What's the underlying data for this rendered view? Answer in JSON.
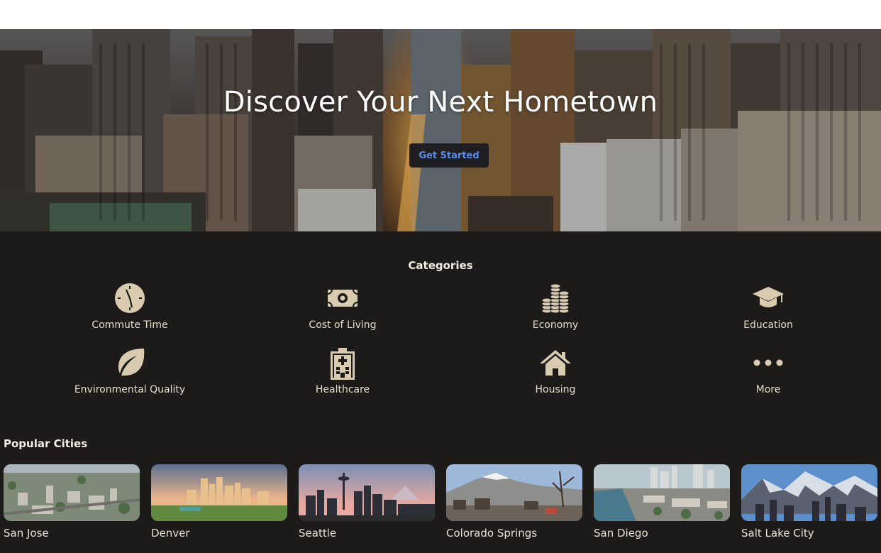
{
  "hero": {
    "title": "Discover Your Next Hometown",
    "cta_label": "Get Started"
  },
  "categories": {
    "title": "Categories",
    "items": [
      {
        "label": "Commute Time",
        "icon": "clock-icon"
      },
      {
        "label": "Cost of Living",
        "icon": "money-bill-icon"
      },
      {
        "label": "Economy",
        "icon": "coins-icon"
      },
      {
        "label": "Education",
        "icon": "graduation-cap-icon"
      },
      {
        "label": "Environmental Quality",
        "icon": "leaf-icon"
      },
      {
        "label": "Healthcare",
        "icon": "hospital-icon"
      },
      {
        "label": "Housing",
        "icon": "house-icon"
      },
      {
        "label": "More",
        "icon": "more-dots-icon"
      }
    ]
  },
  "popular": {
    "title": "Popular Cities",
    "cities": [
      {
        "name": "San Jose"
      },
      {
        "name": "Denver"
      },
      {
        "name": "Seattle"
      },
      {
        "name": "Colorado Springs"
      },
      {
        "name": "San Diego"
      },
      {
        "name": "Salt Lake City"
      }
    ]
  },
  "colors": {
    "background": "#1c1b19",
    "icon": "#d9cbb0",
    "cta_text": "#5b8cf0"
  }
}
